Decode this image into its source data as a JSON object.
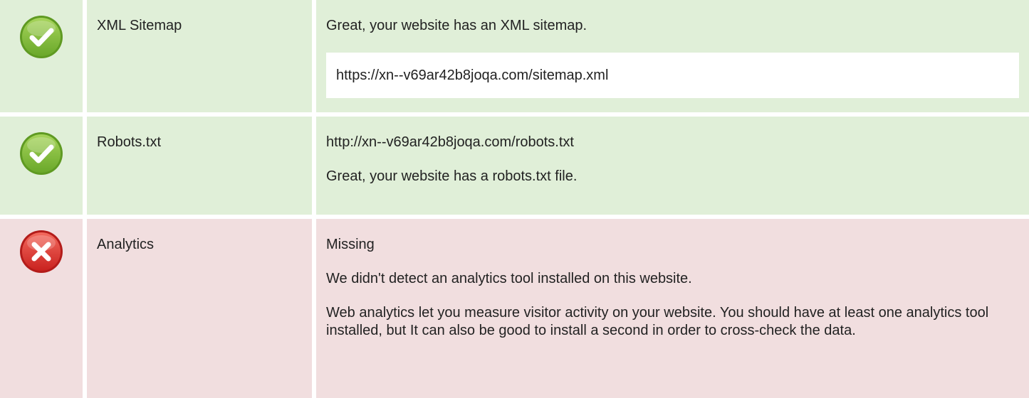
{
  "colors": {
    "pass_bg": "#e0efd8",
    "fail_bg": "#f1dedf",
    "pass_icon": "#8cc63f",
    "fail_icon": "#e23a3a"
  },
  "rows": [
    {
      "status": "pass",
      "icon": "check-circle-icon",
      "label": "XML Sitemap",
      "details": {
        "message": "Great, your website has an XML sitemap.",
        "url": "https://xn--v69ar42b8joqa.com/sitemap.xml"
      }
    },
    {
      "status": "pass",
      "icon": "check-circle-icon",
      "label": "Robots.txt",
      "details": {
        "url": "http://xn--v69ar42b8joqa.com/robots.txt",
        "message": "Great, your website has a robots.txt file."
      }
    },
    {
      "status": "fail",
      "icon": "x-circle-icon",
      "label": "Analytics",
      "details": {
        "status_text": "Missing",
        "message": "We didn't detect an analytics tool installed on this website.",
        "explanation": "Web analytics let you measure visitor activity on your website. You should have at least one analytics tool installed, but It can also be good to install a second in order to cross-check the data."
      }
    }
  ]
}
